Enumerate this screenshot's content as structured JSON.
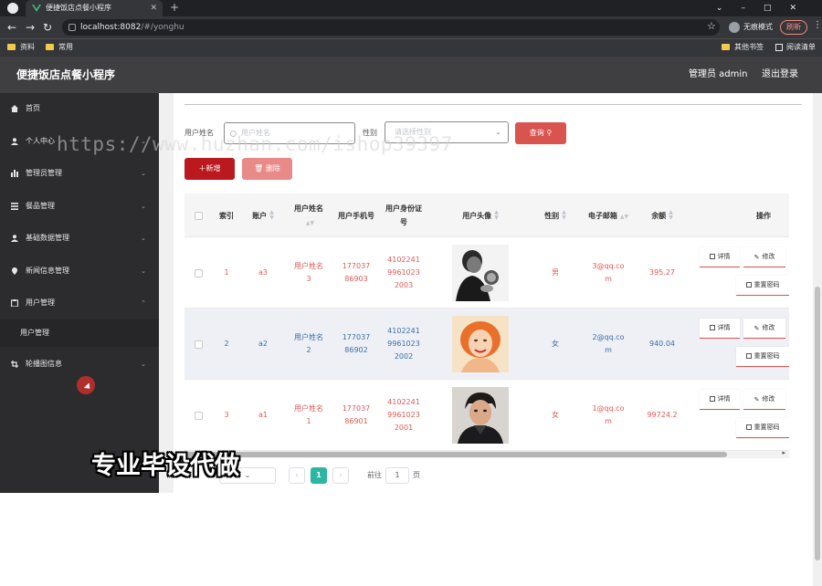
{
  "browser": {
    "tab_title": "便捷饭店点餐小程序",
    "url_host": "localhost:8082",
    "url_path": "/#/yonghu",
    "profile_label": "无痕模式",
    "update_label": "刷新",
    "bookmarks": [
      "资料",
      "常用"
    ],
    "bookmarks_right": [
      "其他书签",
      "阅读清单"
    ],
    "brand_color": "#35363a"
  },
  "header": {
    "app_title": "便捷饭店点餐小程序",
    "admin_label": "管理员 admin",
    "logout_label": "退出登录"
  },
  "sidebar": {
    "items": [
      {
        "label": "首页",
        "icon": "home-icon"
      },
      {
        "label": "个人中心",
        "icon": "user-icon"
      },
      {
        "label": "管理员管理",
        "icon": "chart-icon"
      },
      {
        "label": "餐品管理",
        "icon": "menu-icon"
      },
      {
        "label": "基础数据管理",
        "icon": "user-icon"
      },
      {
        "label": "新闻信息管理",
        "icon": "location-icon"
      },
      {
        "label": "用户管理",
        "icon": "clipboard-icon"
      },
      {
        "label": "用户管理",
        "icon": ""
      },
      {
        "label": "轮播图信息",
        "icon": "crop-icon"
      }
    ]
  },
  "search": {
    "name_label": "用户姓名",
    "name_placeholder": "用户姓名",
    "gender_label": "性别",
    "gender_placeholder": "请选择性别",
    "query_label": "查询",
    "add_label": "新增",
    "delete_label": "删除"
  },
  "table": {
    "columns": [
      "索引",
      "账户",
      "用户姓名",
      "用户手机号",
      "用户身份证号",
      "用户头像",
      "性别",
      "电子邮箱",
      "余额",
      "操作"
    ],
    "rows": [
      {
        "index": "1",
        "account": "a3",
        "name": "用户姓名3",
        "phone": "17703786903",
        "idcard": "410224199610232003",
        "gender": "男",
        "email": "3@qq.com",
        "balance": "395.27",
        "avatar": "man-dark-portrait"
      },
      {
        "index": "2",
        "account": "a2",
        "name": "用户姓名2",
        "phone": "17703786902",
        "idcard": "410224199610232002",
        "gender": "女",
        "email": "2@qq.com",
        "balance": "940.04",
        "avatar": "woman-portrait"
      },
      {
        "index": "3",
        "account": "a1",
        "name": "用户姓名1",
        "phone": "17703786901",
        "idcard": "410224199610232001",
        "gender": "女",
        "email": "1@qq.com",
        "balance": "99724.2",
        "avatar": "man-portrait"
      }
    ],
    "actions": {
      "detail": "详情",
      "edit": "修改",
      "reset": "重置密码"
    }
  },
  "pagination": {
    "current_page": "1",
    "goto_label": "前往",
    "goto_value": "1",
    "page_suffix": "页"
  },
  "watermark": {
    "url_text": "https://www.huzhan.com/ishop39397",
    "caption": "专业毕设代做"
  }
}
